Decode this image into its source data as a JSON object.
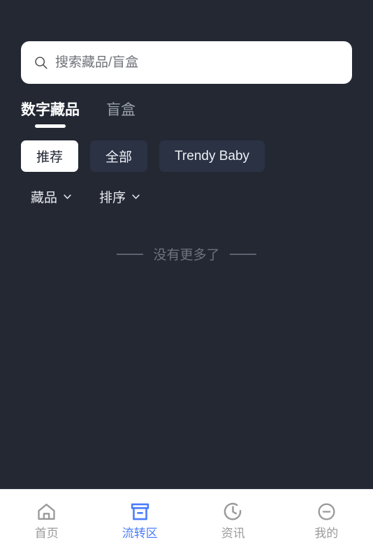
{
  "theme": {
    "background": "#232833",
    "chip_bg": "#2b3244",
    "chip_selected_bg": "#ffffff",
    "accent": "#4a7dfc",
    "muted_text": "#6e737f",
    "nav_bg": "#ffffff",
    "nav_inactive": "#9a9a9a"
  },
  "search": {
    "placeholder": "搜索藏品/盲盒",
    "value": "",
    "icon": "search-icon"
  },
  "tabs": [
    {
      "label": "数字藏品",
      "active": true
    },
    {
      "label": "盲盒",
      "active": false
    }
  ],
  "chips": [
    {
      "label": "推荐",
      "selected": true
    },
    {
      "label": "全部",
      "selected": false
    },
    {
      "label": "Trendy Baby",
      "selected": false
    }
  ],
  "filters": [
    {
      "label": "藏品",
      "icon": "chevron-down-icon"
    },
    {
      "label": "排序",
      "icon": "chevron-down-icon"
    }
  ],
  "empty_state": {
    "text": "没有更多了"
  },
  "bottom_nav": [
    {
      "label": "首页",
      "icon": "home-icon",
      "active": false
    },
    {
      "label": "流转区",
      "icon": "archive-box-icon",
      "active": true
    },
    {
      "label": "资讯",
      "icon": "clock-icon",
      "active": false
    },
    {
      "label": "我的",
      "icon": "circle-minus-icon",
      "active": false
    }
  ]
}
